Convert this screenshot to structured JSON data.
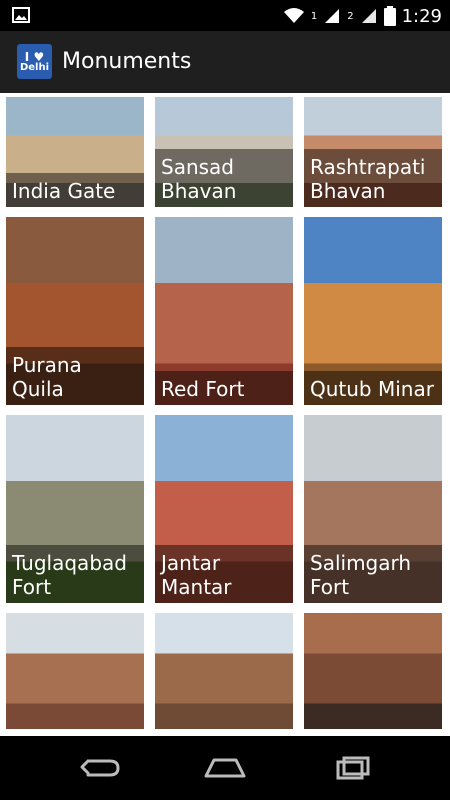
{
  "status_bar": {
    "time": "1:29",
    "sim1_label": "1",
    "sim2_label": "2"
  },
  "app_bar": {
    "logo_top": "I ♥",
    "logo_bottom": "Delhi",
    "title": "Monuments"
  },
  "grid": {
    "items": [
      {
        "label": "India Gate",
        "colors": [
          "#9bb6c8",
          "#c9b08a",
          "#7a7066"
        ]
      },
      {
        "label": "Sansad Bhavan",
        "colors": [
          "#b7c9d8",
          "#c9c1b3",
          "#6f7a5e"
        ]
      },
      {
        "label": "Rashtrapati Bhavan",
        "colors": [
          "#c1cfdb",
          "#c58a6a",
          "#8b4f37"
        ]
      },
      {
        "label": "Purana Quila",
        "colors": [
          "#8a5a3e",
          "#a3552f",
          "#6a3b24"
        ]
      },
      {
        "label": "Red Fort",
        "colors": [
          "#9fb3c6",
          "#b5634b",
          "#8c3b2c"
        ]
      },
      {
        "label": "Qutub Minar",
        "colors": [
          "#4f84c4",
          "#d08a44",
          "#8c5a2a"
        ]
      },
      {
        "label": "Tuglaqabad Fort",
        "colors": [
          "#cbd6de",
          "#8b8b74",
          "#4a6a2c"
        ]
      },
      {
        "label": "Jantar Mantar",
        "colors": [
          "#8bb1d6",
          "#c35e4a",
          "#8a3f2f"
        ]
      },
      {
        "label": "Salimgarh Fort",
        "colors": [
          "#c7ccd0",
          "#a3765d",
          "#7e5a48"
        ]
      },
      {
        "label": "",
        "colors": [
          "#d6dde3",
          "#a77050",
          "#7b4a36"
        ]
      },
      {
        "label": "",
        "colors": [
          "#d6e0e8",
          "#9a6a4a",
          "#6f4a34"
        ]
      },
      {
        "label": "",
        "colors": [
          "#a86d4d",
          "#7b4b36",
          "#3c2b22"
        ]
      }
    ]
  },
  "nav": {
    "back_icon": "back-icon",
    "home_icon": "home-icon",
    "recents_icon": "recents-icon"
  }
}
